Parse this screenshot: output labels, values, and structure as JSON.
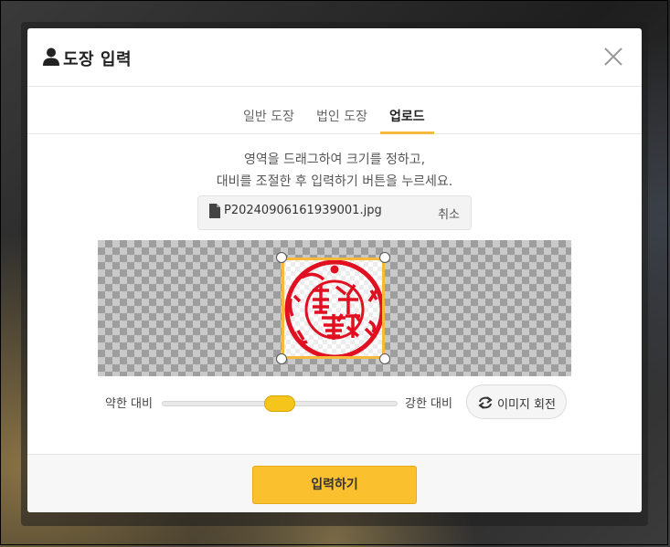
{
  "dialog": {
    "title": "도장 입력",
    "icons": {
      "title": "user-icon",
      "close": "close-icon"
    }
  },
  "tabs": [
    {
      "label": "일반 도장",
      "active": false
    },
    {
      "label": "법인 도장",
      "active": false
    },
    {
      "label": "업로드",
      "active": true
    }
  ],
  "instructions": {
    "line1": "영역을 드래그하여 크기를 정하고,",
    "line2": "대비를 조절한 후 입력하기 버튼을 누르세요."
  },
  "file": {
    "name": "P20240906161939001.jpg",
    "cancel_label": "취소",
    "icon": "file-icon"
  },
  "contrast": {
    "low_label": "약한 대비",
    "high_label": "강한 대비",
    "value": 0.5
  },
  "rotate": {
    "label": "이미지 회전",
    "icon": "rotate-icon"
  },
  "submit": {
    "label": "입력하기"
  },
  "colors": {
    "accent": "#f6b93b",
    "button": "#fbc02d",
    "stamp": "#e01020"
  }
}
